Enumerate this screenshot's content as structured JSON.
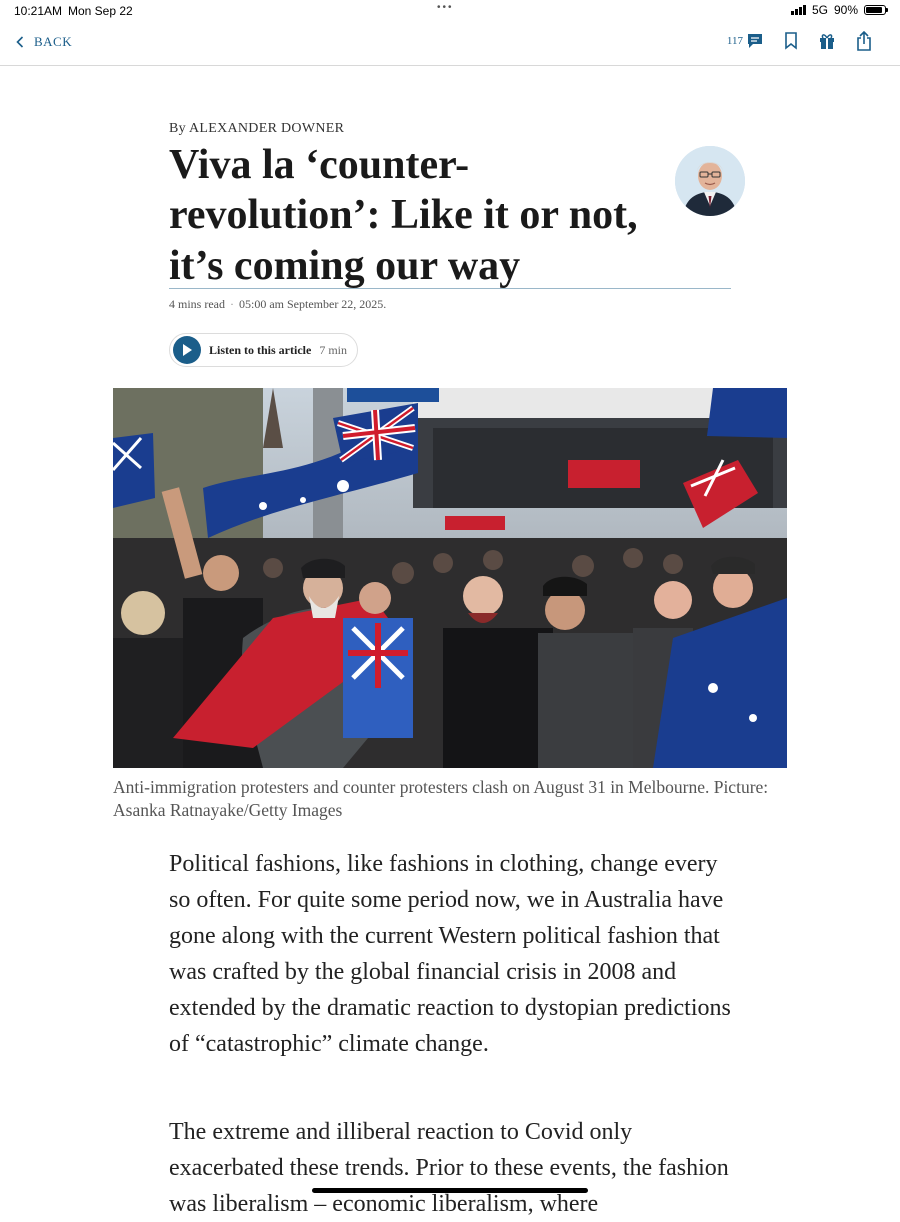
{
  "status_bar": {
    "time": "10:21AM",
    "date": "Mon Sep 22",
    "network": "5G",
    "battery": "90%",
    "battery_level": 0.9
  },
  "toolbar": {
    "back_label": "BACK",
    "comment_count": "117",
    "accent_color": "#1b5e8a",
    "icons": [
      "comments-icon",
      "bookmark-icon",
      "gift-icon",
      "share-icon"
    ]
  },
  "article": {
    "byline": "By ALEXANDER DOWNER",
    "headline": "Viva la ‘counter-revolution’: Like it or not, it’s coming our way",
    "read_time": "4 mins read",
    "published": "05:00 am September 22, 2025.",
    "listen_label": "Listen to this article",
    "listen_duration": "7 min",
    "caption": "Anti-immigration protesters and counter protesters clash on August 31 in Melbourne. Picture: Asanka Ratnayake/Getty Images",
    "paragraphs": [
      "Political fashions, like fashions in clothing, change every so often. For quite some period now, we in Australia have gone along with the current Western political fashion that was crafted by the global financial crisis in 2008 and extended by the dramatic reaction to dystopian predictions of “catastrophic” climate change.",
      "The extreme and illiberal reaction to Covid only exacerbated these trends. Prior to these events, the fashion was liberalism – economic liberalism, where"
    ]
  }
}
